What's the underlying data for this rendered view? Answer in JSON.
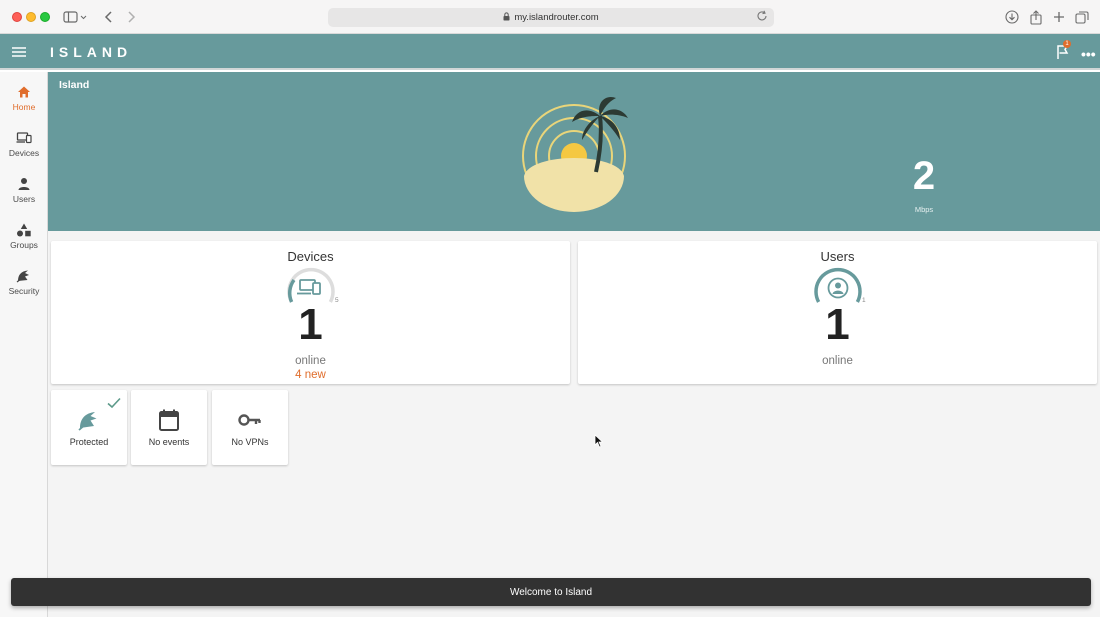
{
  "browser": {
    "url": "my.islandrouter.com"
  },
  "header": {
    "brand": "ISLAND",
    "notification_badge": "1",
    "more_label": "•••"
  },
  "sidebar": {
    "items": [
      {
        "label": "Home",
        "icon": "home-icon",
        "active": true
      },
      {
        "label": "Devices",
        "icon": "devices-icon",
        "active": false
      },
      {
        "label": "Users",
        "icon": "user-icon",
        "active": false
      },
      {
        "label": "Groups",
        "icon": "groups-icon",
        "active": false
      },
      {
        "label": "Security",
        "icon": "security-icon",
        "active": false
      }
    ]
  },
  "hero": {
    "title": "Island",
    "speed_value": "2",
    "speed_unit": "Mbps"
  },
  "devices_card": {
    "title": "Devices",
    "gauge_max": "5",
    "count": "1",
    "status": "online",
    "new_label": "4 new"
  },
  "users_card": {
    "title": "Users",
    "gauge_max": "1",
    "count": "1",
    "status": "online"
  },
  "tiles": [
    {
      "label": "Protected",
      "icon": "security-icon",
      "checked": true
    },
    {
      "label": "No events",
      "icon": "calendar-icon",
      "checked": false
    },
    {
      "label": "No VPNs",
      "icon": "key-icon",
      "checked": false
    }
  ],
  "snackbar": {
    "message": "Welcome to Island"
  },
  "colors": {
    "accent": "#679a9c",
    "highlight": "#e06d2c",
    "sun": "#f5c842",
    "sand": "#f1e2a8"
  }
}
